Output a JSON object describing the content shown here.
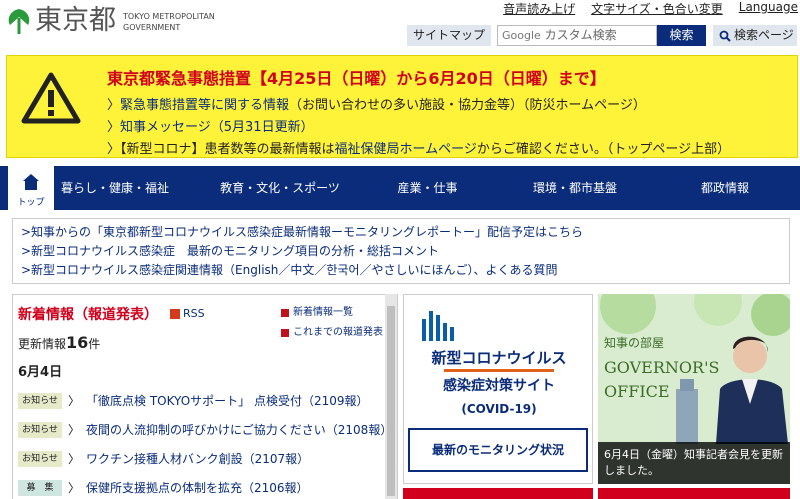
{
  "header": {
    "logo_jp": "東京都",
    "logo_en_line1": "TOKYO METROPOLITAN",
    "logo_en_line2": "GOVERNMENT",
    "top_links": [
      "音声読み上げ",
      "文字サイズ・色合い変更",
      "Language"
    ],
    "sitemap_label": "サイトマップ",
    "search_brand": "Google",
    "search_placeholder": "カスタム検索",
    "search_button": "検索",
    "search_page_label": "検索ページ"
  },
  "alert": {
    "title": "東京都緊急事態措置【4月25日（日曜）から6月20日（日曜）まで】",
    "line1_link": "緊急事態措置等に関する情報",
    "line1_rest": "（お問い合わせの多い施設・協力金等）（防災ホームページ）",
    "line2_link": "知事メッセージ（5月31日更新）",
    "line3_pre": "【新型コロナ】患者数等の最新情報は",
    "line3_link": "福祉保健局ホームページ",
    "line3_post": "からご確認ください。（トップページ上部）"
  },
  "nav": {
    "home_label": "トップ",
    "items": [
      "暮らし・健康・福祉",
      "教育・文化・スポーツ",
      "産業・仕事",
      "環境・都市基盤",
      "都政情報"
    ]
  },
  "notices": [
    ">知事からの「東京都新型コロナウイルス感染症最新情報ーモニタリングレポートー」配信予定はこちら",
    ">新型コロナウイルス感染症　最新のモニタリング項目の分析・総括コメント",
    ">新型コロナウイルス感染症関連情報（English／中文／한국어／やさしいにほんご）、よくある質問"
  ],
  "news": {
    "title": "新着情報（報道発表）",
    "rss": "RSS",
    "link1": "新着情報一覧",
    "link2": "これまでの報道発表",
    "count_label": "更新情報",
    "count_value": "16",
    "count_unit": "件",
    "date": "6月4日",
    "rows": [
      {
        "badge": "お知らせ",
        "text": "「徹底点検 TOKYOサポート」 点検受付（2109報）"
      },
      {
        "badge": "お知らせ",
        "text": "夜間の人流抑制の呼びかけにご協力ください（2108報）"
      },
      {
        "badge": "お知らせ",
        "text": "ワクチン接種人材バンク創設（2107報）"
      },
      {
        "badge": "募　集",
        "text": "保健所支援拠点の体制を拡充（2106報）"
      }
    ]
  },
  "corona": {
    "title1": "新型コロナウイルス",
    "title2": "感染症対策サイト",
    "title3": "(COVID-19)",
    "button": "最新のモニタリング状況"
  },
  "governor": {
    "label": "知事の部屋",
    "title1": "GOVERNOR'S",
    "title2": "OFFICE",
    "caption": "6月4日（金曜）知事記者会見を更新しました。"
  },
  "colors": {
    "brand_navy": "#0a2c7a",
    "alert_yellow": "#fff33a",
    "alert_red": "#d1001c",
    "logo_green": "#2a9a3c"
  }
}
